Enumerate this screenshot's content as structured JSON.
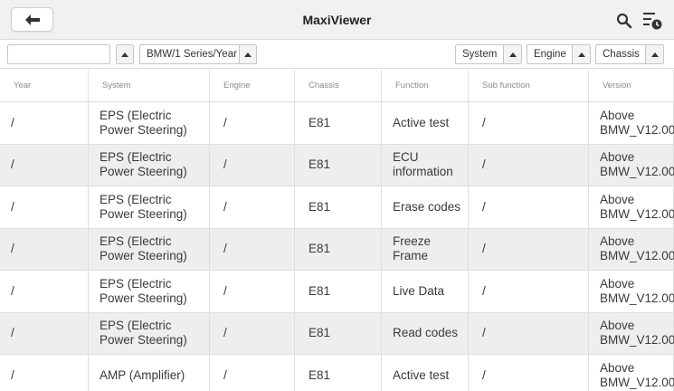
{
  "header": {
    "title": "MaxiViewer",
    "back_icon": "back-arrow-icon",
    "search_icon": "search-icon",
    "history_icon": "history-icon"
  },
  "filters": {
    "left_input": "",
    "vehicle": "BMW/1 Series/Year",
    "system": "System",
    "engine": "Engine",
    "chassis": "Chassis"
  },
  "table": {
    "columns": [
      "Year",
      "System",
      "Engine",
      "Chassis",
      "Function",
      "Sub function",
      "Version"
    ],
    "rows": [
      [
        "/",
        "EPS (Electric Power Steering)",
        "/",
        "E81",
        "Active test",
        "/",
        "Above BMW_V12.00"
      ],
      [
        "/",
        "EPS (Electric Power Steering)",
        "/",
        "E81",
        "ECU information",
        "/",
        "Above BMW_V12.00"
      ],
      [
        "/",
        "EPS (Electric Power Steering)",
        "/",
        "E81",
        "Erase codes",
        "/",
        "Above BMW_V12.00"
      ],
      [
        "/",
        "EPS (Electric Power Steering)",
        "/",
        "E81",
        "Freeze Frame",
        "/",
        "Above BMW_V12.00"
      ],
      [
        "/",
        "EPS (Electric Power Steering)",
        "/",
        "E81",
        "Live Data",
        "/",
        "Above BMW_V12.00"
      ],
      [
        "/",
        "EPS (Electric Power Steering)",
        "/",
        "E81",
        "Read codes",
        "/",
        "Above BMW_V12.00"
      ],
      [
        "/",
        "AMP (Amplifier)",
        "/",
        "E81",
        "Active test",
        "/",
        "Above BMW_V12.00"
      ]
    ]
  },
  "colors": {
    "topbar": "#f1f1f1",
    "row_alt": "#eeeeee",
    "border": "#dcdcdc"
  }
}
